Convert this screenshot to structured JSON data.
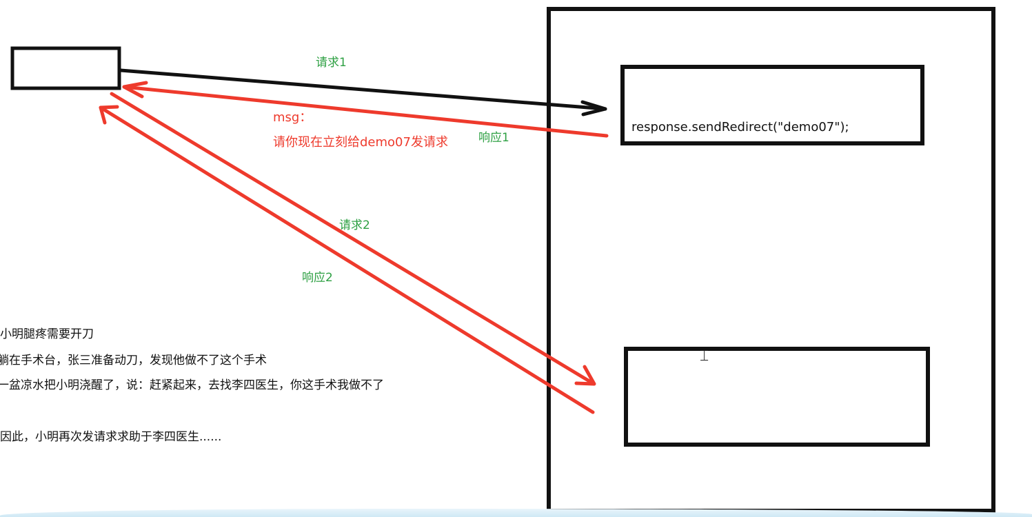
{
  "labels": {
    "request1": "请求1",
    "response1": "响应1",
    "request2": "请求2",
    "response2": "响应2",
    "msg_title": "msg：",
    "msg_body": "请你现在立刻给demo07发请求"
  },
  "server_code": "response.sendRedirect(\"demo07\");",
  "story": [
    "小明腿疼需要开刀",
    "躺在手术台，张三准备动刀，发现他做不了这个手术",
    "一盆凉水把小明浇醒了，说：赶紧起来，去找李四医生，你这手术我做不了",
    "因此，小明再次发请求求助于李四医生......"
  ],
  "colors": {
    "request_arrow": "#111111",
    "response_arrow": "#ee3a2c",
    "label_green": "#2ea043",
    "label_red": "#ee3a2c"
  }
}
